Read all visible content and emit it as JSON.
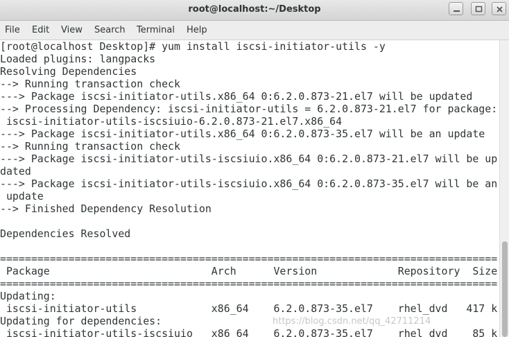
{
  "window": {
    "title": "root@localhost:~/Desktop"
  },
  "menubar": {
    "items": [
      "File",
      "Edit",
      "View",
      "Search",
      "Terminal",
      "Help"
    ]
  },
  "terminal": {
    "lines": [
      "[root@localhost Desktop]# yum install iscsi-initiator-utils -y",
      "Loaded plugins: langpacks",
      "Resolving Dependencies",
      "--> Running transaction check",
      "---> Package iscsi-initiator-utils.x86_64 0:6.2.0.873-21.el7 will be updated",
      "--> Processing Dependency: iscsi-initiator-utils = 6.2.0.873-21.el7 for package:",
      " iscsi-initiator-utils-iscsiuio-6.2.0.873-21.el7.x86_64",
      "---> Package iscsi-initiator-utils.x86_64 0:6.2.0.873-35.el7 will be an update",
      "--> Running transaction check",
      "---> Package iscsi-initiator-utils-iscsiuio.x86_64 0:6.2.0.873-21.el7 will be up",
      "dated",
      "---> Package iscsi-initiator-utils-iscsiuio.x86_64 0:6.2.0.873-35.el7 will be an",
      " update",
      "--> Finished Dependency Resolution",
      "",
      "Dependencies Resolved",
      "",
      "================================================================================",
      " Package                          Arch      Version             Repository  Size",
      "================================================================================",
      "Updating:",
      " iscsi-initiator-utils            x86_64    6.2.0.873-35.el7    rhel_dvd   417 k",
      "Updating for dependencies:",
      " iscsi-initiator-utils-iscsiuio   x86_64    6.2.0.873-35.el7    rhel_dvd    85 k"
    ]
  },
  "watermark": "https://blog.csdn.net/qq_42711214"
}
